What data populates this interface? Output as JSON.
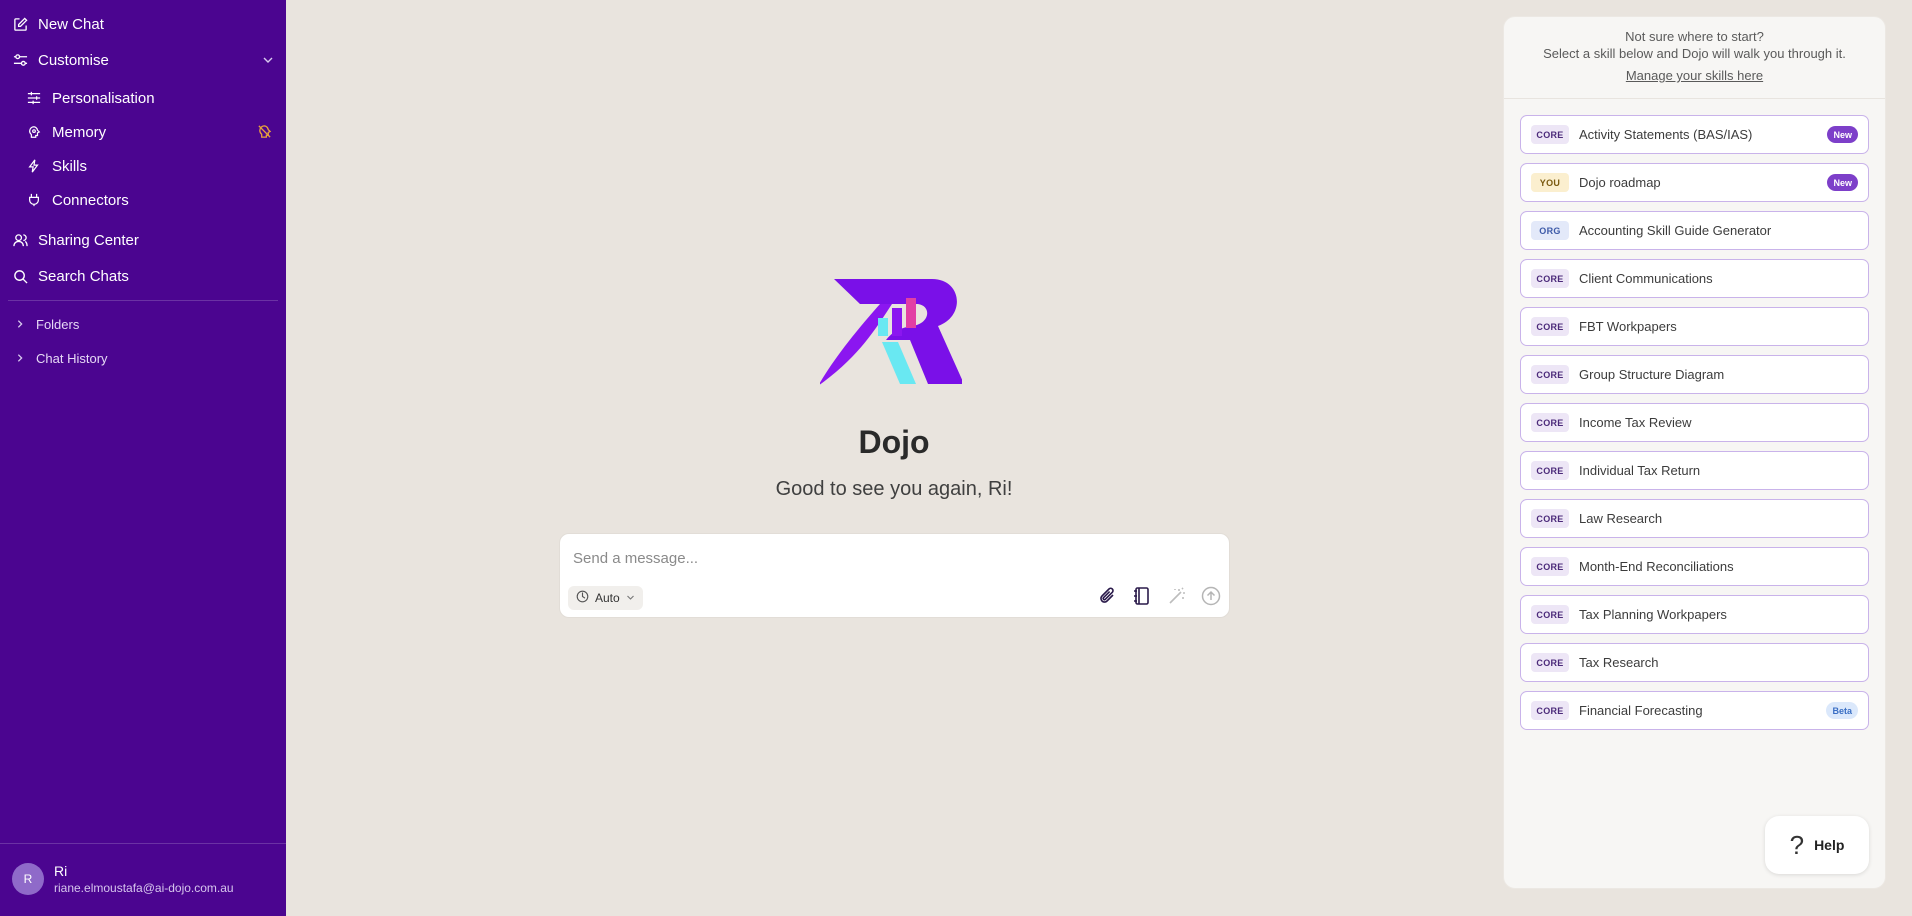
{
  "sidebar": {
    "new_chat": "New Chat",
    "customise": "Customise",
    "sub_items": [
      "Personalisation",
      "Memory",
      "Skills",
      "Connectors"
    ],
    "sharing_center": "Sharing Center",
    "search_chats": "Search Chats",
    "folders": "Folders",
    "chat_history": "Chat History",
    "user": {
      "initial": "R",
      "name": "Ri",
      "email": "riane.elmoustafa@ai-dojo.com.au"
    }
  },
  "main": {
    "title": "Dojo",
    "subtitle": "Good to see you again, Ri!",
    "composer": {
      "placeholder": "Send a message...",
      "model": "Auto"
    }
  },
  "panel": {
    "line1": "Not sure where to start?",
    "line2": "Select a skill below and Dojo will walk you through it.",
    "manage_link": "Manage your skills here",
    "skills": [
      {
        "tag": "CORE",
        "label": "Activity Statements (BAS/IAS)",
        "badge": "New"
      },
      {
        "tag": "YOU",
        "label": "Dojo roadmap",
        "badge": "New"
      },
      {
        "tag": "ORG",
        "label": "Accounting Skill Guide Generator",
        "badge": ""
      },
      {
        "tag": "CORE",
        "label": "Client Communications",
        "badge": ""
      },
      {
        "tag": "CORE",
        "label": "FBT Workpapers",
        "badge": ""
      },
      {
        "tag": "CORE",
        "label": "Group Structure Diagram",
        "badge": ""
      },
      {
        "tag": "CORE",
        "label": "Income Tax Review",
        "badge": ""
      },
      {
        "tag": "CORE",
        "label": "Individual Tax Return",
        "badge": ""
      },
      {
        "tag": "CORE",
        "label": "Law Research",
        "badge": ""
      },
      {
        "tag": "CORE",
        "label": "Month-End Reconciliations",
        "badge": ""
      },
      {
        "tag": "CORE",
        "label": "Tax Planning Workpapers",
        "badge": ""
      },
      {
        "tag": "CORE",
        "label": "Tax Research",
        "badge": ""
      },
      {
        "tag": "CORE",
        "label": "Financial Forecasting",
        "badge": "Beta"
      }
    ],
    "help": "Help"
  },
  "colors": {
    "sidebar_bg": "#4b0590",
    "page_bg": "#e9e4de",
    "accent": "#7d3fc9"
  }
}
